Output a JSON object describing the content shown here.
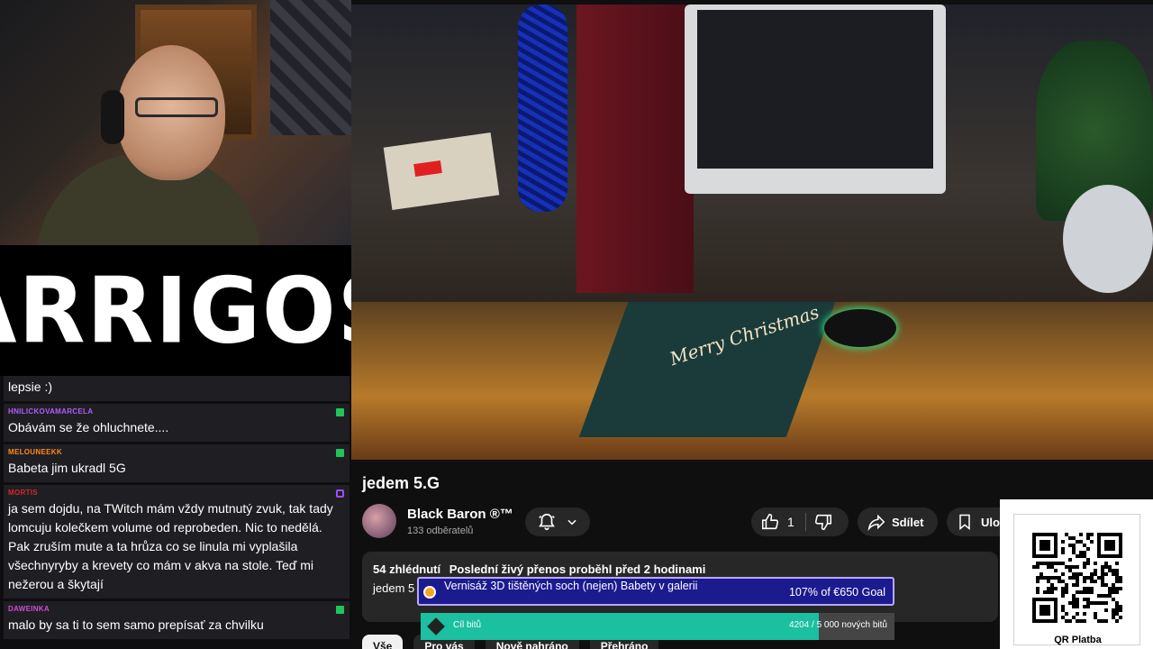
{
  "logo": {
    "text": "ARRIGOS"
  },
  "chat": {
    "messages": [
      {
        "user": "",
        "color": "#ffffff",
        "text": "lepsie :)",
        "badge": ""
      },
      {
        "user": "HNILICKOVAMARCELA",
        "color": "#b05cff",
        "text": "Obávám se že ohluchnete....",
        "badge": "green"
      },
      {
        "user": "MELOUNEEKK",
        "color": "#ff8a1e",
        "text": "Babeta jim ukradl 5G",
        "badge": "green"
      },
      {
        "user": "MORTIS",
        "color": "#d6262e",
        "text": "ja sem dojdu, na TWitch mám vždy mutnutý zvuk, tak tady lomcuju kolečkem volume od reprobeden. Nic to nedělá. Pak zruším mute a ta hrůza co se linula mi vyplašila všechnyryby a krevety co mám v akva na stole. Teď mi nežerou a škytají",
        "badge": "purple"
      },
      {
        "user": "DAWEINKA",
        "color": "#d24bd8",
        "text": "malo by sa ti to sem samo prepísať za chvilku",
        "badge": "green"
      }
    ]
  },
  "video": {
    "mat_text": "Merry Christmas",
    "title": "jedem 5.G",
    "channel": "Black Baron ®™",
    "subscribers": "133 odběratelů",
    "likes": "1",
    "share_label": "Sdílet",
    "save_label": "Uložit",
    "views": "54 zhlédnutí",
    "stream_info": "Poslední živý přenos proběhl před 2 hodinami",
    "description": "jedem 5"
  },
  "chips": [
    "Vše",
    "Pro vás",
    "Nově nahráno",
    "Přehráno"
  ],
  "goal": {
    "title": "Vernisáž 3D tištěných soch (nejen) Babety v galerii",
    "percent_label": "107% of €650 Goal"
  },
  "bits": {
    "label": "Cíl bitů",
    "count": "4204 / 5 000 nových bitů",
    "progress": 0.84
  },
  "qr": {
    "label": "QR Platba"
  }
}
